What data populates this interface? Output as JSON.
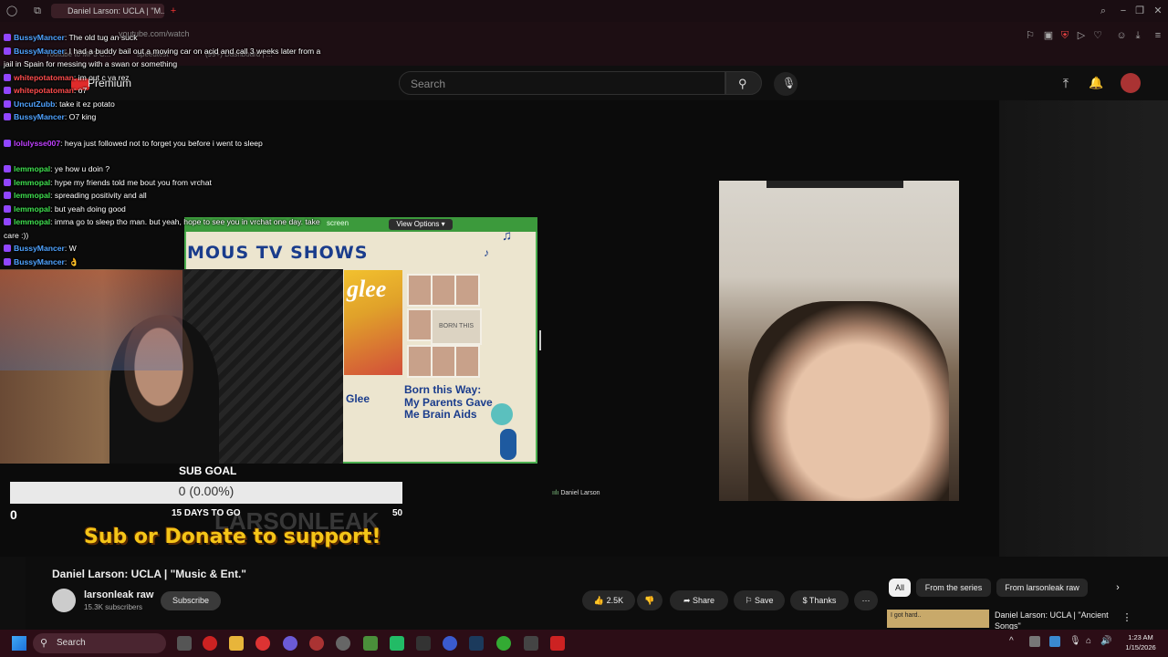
{
  "browser": {
    "tab_title": "Daniel Larson: UCLA | \"M...",
    "address_hint": "youtube.com/watch",
    "bookmarks": [
      "Youtube to MP3 C...",
      "speedtest",
      "(99+) Dashboard | ..."
    ]
  },
  "youtube": {
    "search_placeholder": "Search",
    "premium_label": "Premium"
  },
  "chat": [
    {
      "user": "BussyMancer",
      "color": "#4fa3ff",
      "text": "The old tug an suck"
    },
    {
      "user": "BussyMancer",
      "color": "#4fa3ff",
      "text": "I had a buddy bail out a moving car on acid and call 3 weeks later from a jail in Spain for messing with a swan or something"
    },
    {
      "user": "whitepotatoman",
      "color": "#ff4d4d",
      "text": "im out c ya rez"
    },
    {
      "user": "whitepotatoman",
      "color": "#ff4d4d",
      "text": "o7"
    },
    {
      "user": "UncutZubb",
      "color": "#4fa3ff",
      "text": "take it ez potato"
    },
    {
      "user": "BussyMancer",
      "color": "#4fa3ff",
      "text": "O7 king"
    },
    {
      "user": "lolulysse007",
      "color": "#c040ff",
      "text": "heya just followed not to forget you before i went to sleep"
    },
    {
      "user": "lemmopal",
      "color": "#3fe04f",
      "text": "ye how u doin ?"
    },
    {
      "user": "lemmopal",
      "color": "#3fe04f",
      "text": "hype my friends told me bout you from vrchat"
    },
    {
      "user": "lemmopal",
      "color": "#3fe04f",
      "text": "spreading positivity and all"
    },
    {
      "user": "lemmopal",
      "color": "#3fe04f",
      "text": "but yeah doing good"
    },
    {
      "user": "lemmopal",
      "color": "#3fe04f",
      "text": "imma go to sleep tho man. but yeah, hope to see you in vrchat one day. take care :))"
    },
    {
      "user": "BussyMancer",
      "color": "#4fa3ff",
      "text": "W"
    },
    {
      "user": "BussyMancer",
      "color": "#4fa3ff",
      "text": "👌"
    }
  ],
  "screen_share": {
    "share_text": "screen",
    "view_options": "View Options",
    "slide_title": "MOUS TV SHOWS",
    "glee_logo": "glee",
    "glee_label": "Glee",
    "born_label": "Born this Way: My Parents Gave Me Brain Aids",
    "born_sticker": "BORN THIS WAY"
  },
  "facecam_name": "Daniel Larson",
  "sub_goal": {
    "title": "SUB GOAL",
    "progress_text": "0 (0.00%)",
    "progress_fraction": 0,
    "min": "0",
    "days_left": "15 DAYS TO GO",
    "max": "50",
    "watermark": "LARSONLEAK",
    "cta": "Sub or Donate to support!"
  },
  "video": {
    "title": "Daniel Larson: UCLA | \"Music & Ent.\"",
    "channel": "larsonleak raw",
    "subscribers": "15.3K subscribers",
    "subscribe_label": "Subscribe",
    "likes": "2.5K",
    "share_label": "Share",
    "save_label": "Save",
    "thanks_label": "Thanks"
  },
  "related": {
    "chips": [
      "All",
      "From the series",
      "From larsonleak raw"
    ],
    "item_title": "Daniel Larson: UCLA | \"Ancient Songs\"",
    "item_thumb_text": "I got hard.."
  },
  "taskbar": {
    "search_label": "Search",
    "time": "1:23 AM",
    "date": "1/15/2026"
  },
  "colors": {
    "accent_red": "#e02b2b",
    "share_green": "#4caf50",
    "goal_yellow": "#f5c518"
  }
}
